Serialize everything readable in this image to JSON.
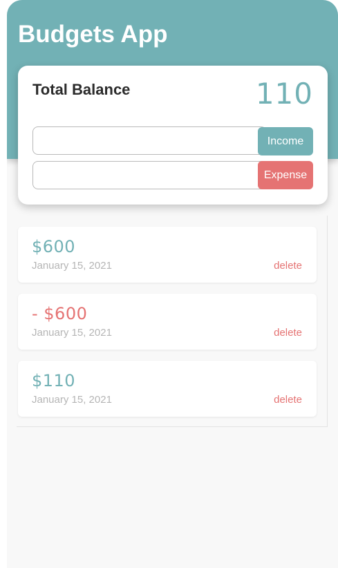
{
  "app": {
    "title": "Budgets App"
  },
  "balance": {
    "label": "Total Balance",
    "value": "110"
  },
  "form": {
    "income_input_value": "",
    "expense_input_value": "",
    "income_button": "Income",
    "expense_button": "Expense"
  },
  "transactions": [
    {
      "amount": "$600",
      "type": "income",
      "date": "January 15, 2021",
      "delete_label": "delete"
    },
    {
      "amount": "- $600",
      "type": "expense",
      "date": "January 15, 2021",
      "delete_label": "delete"
    },
    {
      "amount": "$110",
      "type": "income",
      "date": "January 15, 2021",
      "delete_label": "delete"
    }
  ],
  "colors": {
    "primary": "#72b1b5",
    "expense": "#e57373",
    "background": "#f8f8f8"
  }
}
